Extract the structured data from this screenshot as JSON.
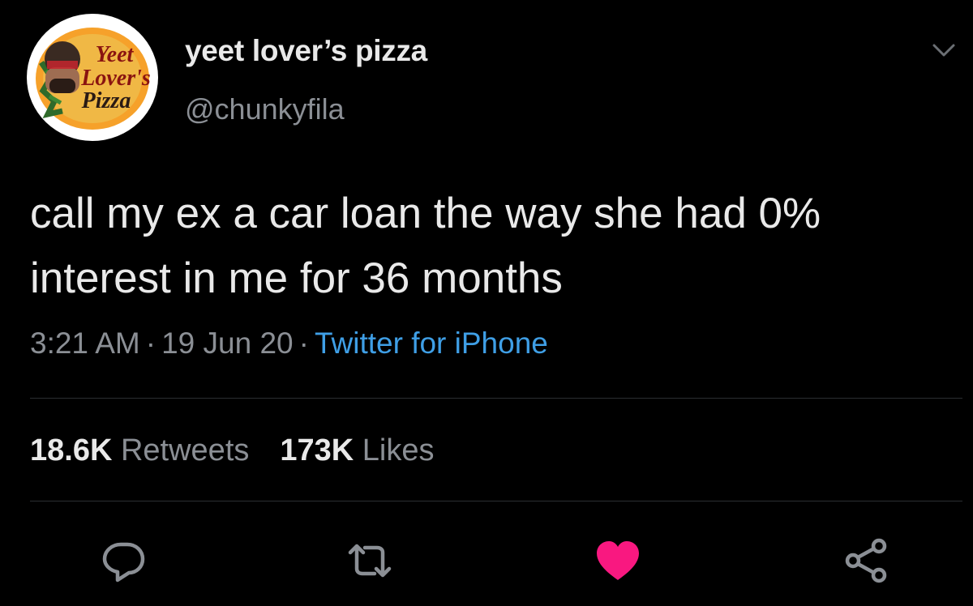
{
  "user": {
    "display_name": "yeet lover’s pizza",
    "handle": "@chunkyfila",
    "avatar_text": [
      "Yeet",
      "Lover's",
      "Pizza"
    ]
  },
  "tweet": {
    "text": "call my ex a car loan the way she had 0% interest in me for 36 months",
    "time": "3:21 AM",
    "date": "19 Jun 20",
    "source": "Twitter for iPhone",
    "separator": "·"
  },
  "stats": {
    "retweets_count": "18.6K",
    "retweets_label": "Retweets",
    "likes_count": "173K",
    "likes_label": "Likes"
  },
  "actions": [
    {
      "name": "reply-icon"
    },
    {
      "name": "retweet-icon"
    },
    {
      "name": "like-icon",
      "state": "liked"
    },
    {
      "name": "share-icon"
    }
  ],
  "colors": {
    "background": "#000000",
    "primary_text": "#e9e9e9",
    "secondary_text": "#8b8f95",
    "link": "#3f9fe6",
    "like": "#f91880",
    "divider": "#2b2e31"
  }
}
